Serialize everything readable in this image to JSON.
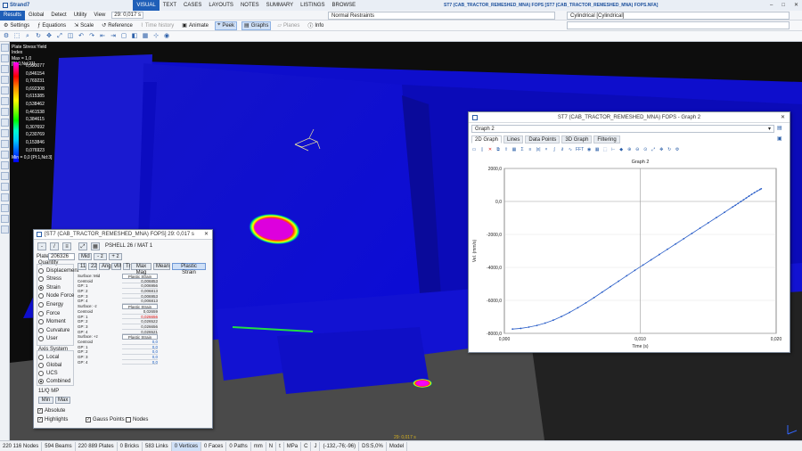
{
  "titlebar": {
    "app_name": "Strand7",
    "menus": [
      "Results",
      "Global",
      "Detect",
      "Utility",
      "View"
    ],
    "time_field": "29: 0,017 s",
    "ribbon_tabs": [
      "VISUAL",
      "TEXT",
      "CASES",
      "LAYOUTS",
      "NOTES",
      "SUMMARY",
      "LISTINGS",
      "BROWSE"
    ],
    "file_path": "ST7 (CAB_TRACTOR_REMESHED_MNA) FOPS [ST7 (CAB_TRACTOR_REMESHED_MNA) FOPS.NFA]",
    "freedom_case": "Normal Restraints",
    "coord_system": "Cylindrical [Cylindrical]"
  },
  "toolbar2": {
    "settings": "Settings",
    "equations": "Equations",
    "scale": "Scale",
    "reference": "Reference",
    "time_history": "Time history",
    "animate": "Animate",
    "peek": "Peek",
    "graphs": "Graphs",
    "planes": "Planes",
    "info": "Info"
  },
  "legend": {
    "title": "Plate Stress:Yield Index",
    "max_label": "Max = 1,0 [Pl:0,Nd:21]",
    "values": [
      "0,923077",
      "0,846154",
      "0,769231",
      "0,692308",
      "0,615385",
      "0,538462",
      "0,461538",
      "0,384615",
      "0,307692",
      "0,230769",
      "0,153846",
      "0,076923"
    ],
    "min_label": "Min = 0,0 [Pl:1,Nd:3]",
    "colors": [
      "#ff00ff",
      "#ff0000",
      "#ff8800",
      "#ffff00",
      "#00ff00",
      "#00ffcc",
      "#00ccff",
      "#0066ff",
      "#0000ff"
    ]
  },
  "plate_dialog": {
    "title": "[ST7 (CAB_TRACTOR_REMESHED_MNA) FOPS] 29: 0,017 s",
    "plate_label": "Plate",
    "plate_number": "206326",
    "property": "PSHELL 26 / MAT 1",
    "layer_buttons": [
      "Mid",
      "- z",
      "+ z"
    ],
    "quantity_label": "Quantity",
    "quantities": [
      "Displacement",
      "Stress",
      "Strain",
      "Node Force",
      "Energy",
      "Force",
      "Moment",
      "Curvature",
      "User"
    ],
    "selected_quantity": "Strain",
    "component_tabs": [
      "11",
      "22",
      "Ang",
      "vM",
      "Tr",
      "Max Mag",
      "Mean",
      "Plastic Strain"
    ],
    "axis_label": "Axis System",
    "axes": [
      "Local",
      "Global",
      "UCS",
      "Combined"
    ],
    "selected_axis": "Combined",
    "units": "11/Q MP",
    "min_btn": "Min",
    "max_btn": "Max",
    "absolute": "Absolute",
    "highlights": "Highlights",
    "gauss_points": "Gauss Points",
    "nodes": "Nodes",
    "table": [
      {
        "name": "Surface: Mid",
        "value": "Plastic Strain",
        "hdr": true
      },
      {
        "name": "Centroid",
        "value": "0,006853"
      },
      {
        "name": "GP: 1",
        "value": "0,006956"
      },
      {
        "name": "GP: 2",
        "value": "0,006813"
      },
      {
        "name": "GP: 3",
        "value": "0,006953"
      },
      {
        "name": "GP: 4",
        "value": "0,006813"
      },
      {
        "name": "Surface: -z",
        "value": "Plastic Strain",
        "hdr": true
      },
      {
        "name": "Centroid",
        "value": "0,02659"
      },
      {
        "name": "GP: 1",
        "value": "0,026656",
        "cls": "red"
      },
      {
        "name": "GP: 2",
        "value": "0,026522"
      },
      {
        "name": "GP: 3",
        "value": "0,026656"
      },
      {
        "name": "GP: 4",
        "value": "0,026521"
      },
      {
        "name": "Surface: +z",
        "value": "Plastic Strain",
        "hdr": true
      },
      {
        "name": "Centroid",
        "value": "0,0",
        "cls": "blue"
      },
      {
        "name": "GP: 1",
        "value": "0,0",
        "cls": "blue"
      },
      {
        "name": "GP: 2",
        "value": "0,0",
        "cls": "blue"
      },
      {
        "name": "GP: 3",
        "value": "0,0",
        "cls": "blue"
      },
      {
        "name": "GP: 4",
        "value": "0,0",
        "cls": "blue"
      }
    ]
  },
  "graph_window": {
    "title": "ST7 (CAB_TRACTOR_REMESHED_MNA) FOPS - Graph 2",
    "selected_graph": "Graph 2",
    "tabs": [
      "2D Graph",
      "Lines",
      "Data Points",
      "3D Graph",
      "Filtering"
    ],
    "active_tab": "2D Graph",
    "fft_label": "FFT"
  },
  "chart_data": {
    "type": "line",
    "title": "Graph 2",
    "xlabel": "Time (s)",
    "ylabel": "Vel. (mm/s)",
    "xlim": [
      0.0,
      0.02
    ],
    "ylim": [
      -8000,
      2000
    ],
    "x_ticks": [
      "0,000",
      "0,010",
      "0,020"
    ],
    "y_ticks": [
      "2000,0",
      "0,0",
      "-2000,0",
      "-4000,0",
      "-6000,0",
      "-8000,0"
    ],
    "x_tick_values": [
      0.0,
      0.01,
      0.02
    ],
    "y_tick_values": [
      2000,
      0,
      -2000,
      -4000,
      -6000,
      -8000
    ],
    "series_color": "#2a5ec8",
    "series": [
      {
        "name": "",
        "x": [
          0.0006,
          0.0012,
          0.0018,
          0.0024,
          0.003,
          0.0036,
          0.0042,
          0.0048,
          0.0054,
          0.006,
          0.0066,
          0.0072,
          0.0078,
          0.0084,
          0.009,
          0.0096,
          0.0102,
          0.0108,
          0.0114,
          0.012,
          0.0126,
          0.0132,
          0.0138,
          0.0144,
          0.015,
          0.0156,
          0.0162,
          0.0168,
          0.017,
          0.0172,
          0.0174,
          0.0176,
          0.0178,
          0.018,
          0.0182,
          0.0184,
          0.0186,
          0.0188,
          0.0189
        ],
        "y": [
          -7740,
          -7700,
          -7620,
          -7520,
          -7380,
          -7200,
          -6980,
          -6730,
          -6450,
          -6150,
          -5830,
          -5500,
          -5170,
          -4840,
          -4510,
          -4180,
          -3860,
          -3540,
          -3220,
          -2900,
          -2580,
          -2260,
          -1940,
          -1620,
          -1300,
          -980,
          -660,
          -330,
          -230,
          -120,
          -10,
          100,
          210,
          320,
          430,
          530,
          630,
          720,
          770
        ]
      }
    ]
  },
  "statusbar": {
    "items": [
      "220 116 Nodes",
      "594 Beams",
      "220 889 Plates",
      "0 Bricks",
      "583 Links",
      "0 Vertices",
      "0 Faces",
      "0 Paths",
      "mm",
      "N",
      "t",
      "MPa",
      "C",
      "J",
      "(-132,-76;-96)",
      "DS:5,0%",
      "Model"
    ],
    "viewport_time": "29: 0,017 s"
  }
}
